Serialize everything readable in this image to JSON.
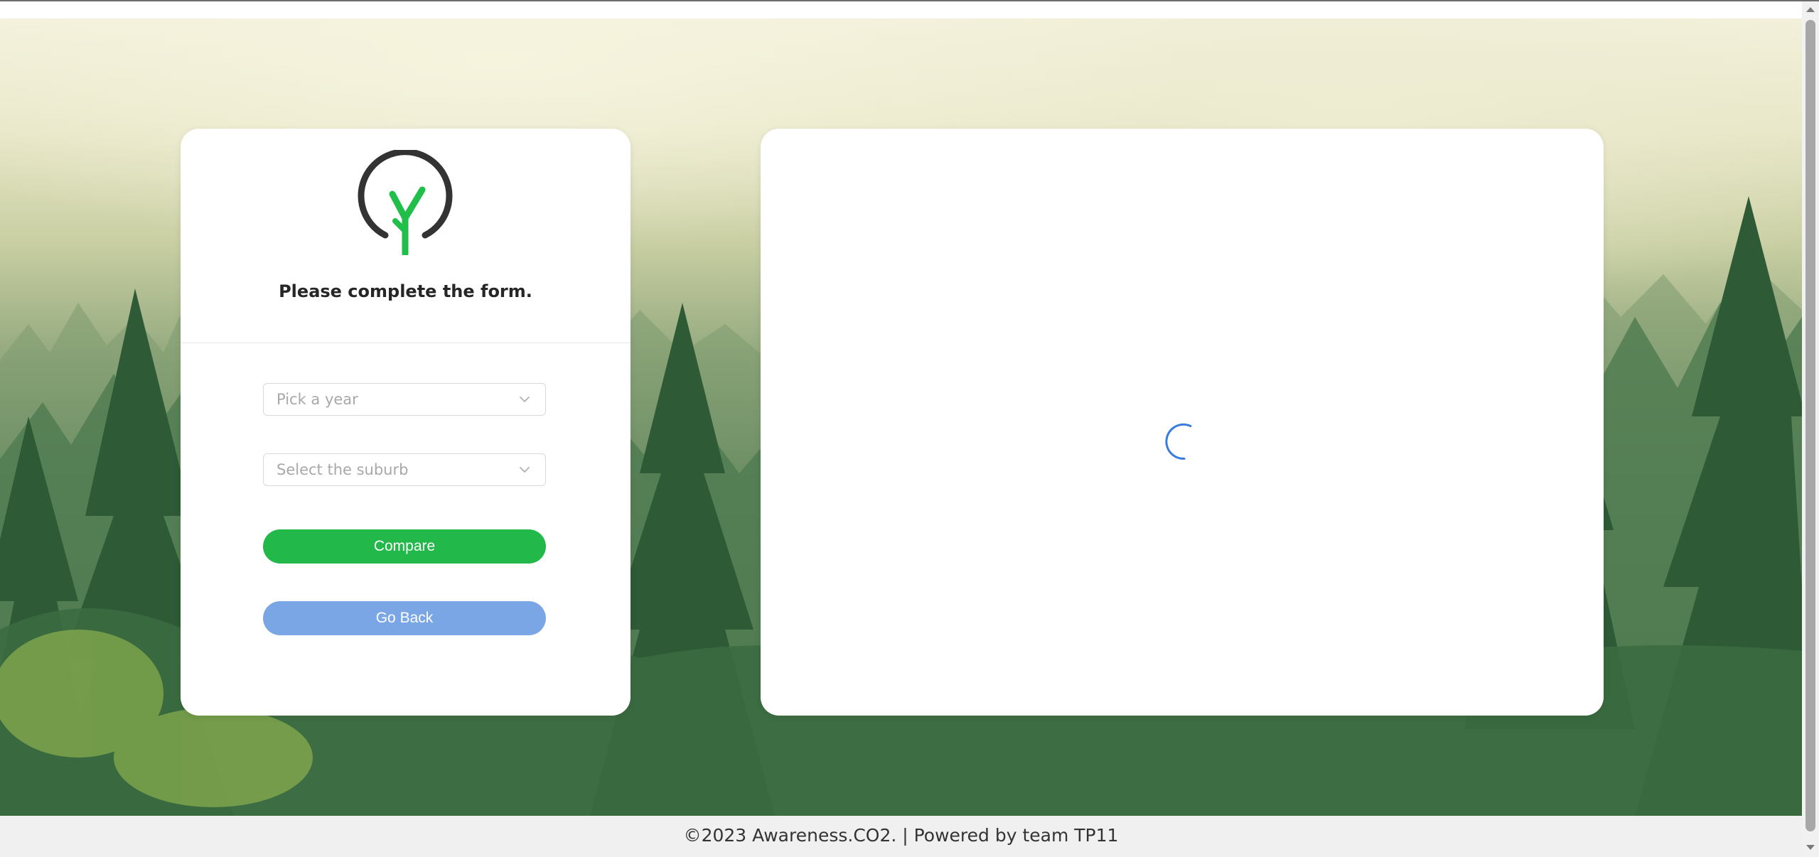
{
  "form": {
    "title": "Please complete the form.",
    "year_placeholder": "Pick a year",
    "suburb_placeholder": "Select the suburb",
    "compare_label": "Compare",
    "back_label": "Go Back"
  },
  "footer": {
    "text": "©2023 Awareness.CO2. | Powered by team TP11"
  },
  "icons": {
    "logo": "tree-logo-icon",
    "year_chevron": "chevron-down-icon",
    "suburb_chevron": "chevron-down-icon",
    "loading": "loading-spinner-icon"
  },
  "colors": {
    "compare_button": "#22b84a",
    "back_button": "#7aa6e6",
    "logo_ring": "#333333",
    "logo_sprout": "#1fbf4a",
    "spinner": "#3a7be0",
    "footer_bg": "#f0f0f0"
  }
}
